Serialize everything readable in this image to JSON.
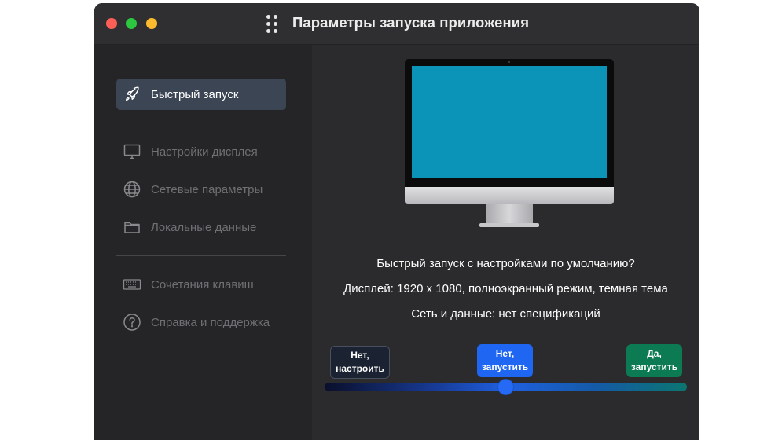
{
  "window": {
    "title": "Параметры запуска приложения"
  },
  "sidebar": {
    "items": [
      {
        "label": "Быстрый запуск",
        "icon": "rocket-icon",
        "active": true
      },
      {
        "label": "Настройки дисплея",
        "icon": "monitor-icon",
        "active": false
      },
      {
        "label": "Сетевые параметры",
        "icon": "globe-icon",
        "active": false
      },
      {
        "label": "Локальные данные",
        "icon": "folder-icon",
        "active": false
      },
      {
        "label": "Сочетания клавиш",
        "icon": "keyboard-icon",
        "active": false
      },
      {
        "label": "Справка и поддержка",
        "icon": "help-icon",
        "active": false
      }
    ]
  },
  "main": {
    "question": "Быстрый запуск с настройками по умолчанию?",
    "display_info": "Дисплей: 1920 x 1080, полноэкранный режим, темная тема",
    "network_info": "Сеть и данные: нет спецификаций",
    "choices": [
      {
        "line1": "Нет,",
        "line2": "настроить",
        "color": "#1b2232"
      },
      {
        "line1": "Нет,",
        "line2": "запустить",
        "color": "#1f66f2"
      },
      {
        "line1": "Да,",
        "line2": "запустить",
        "color": "#0c7a52"
      }
    ],
    "slider_position": 0.5
  },
  "colors": {
    "accent": "#1f66f2",
    "confirm": "#0c7a52",
    "screen": "#0b93b8"
  }
}
